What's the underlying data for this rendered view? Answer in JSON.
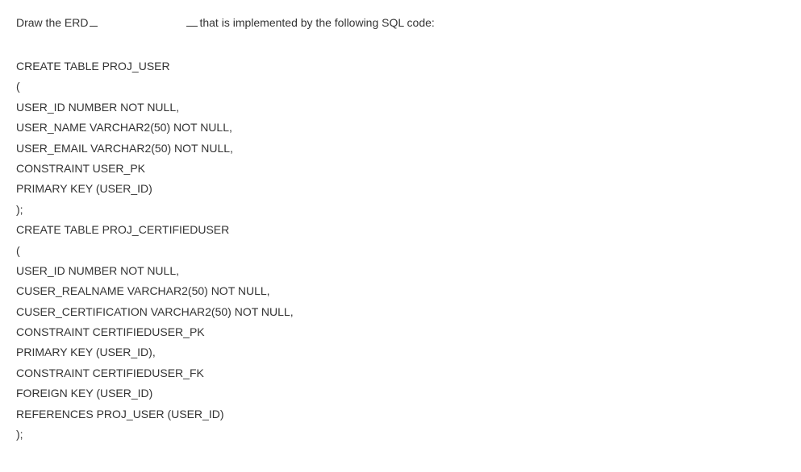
{
  "header": {
    "part1": "Draw the ERD",
    "part2": "that is implemented by the following SQL code:"
  },
  "code": {
    "lines": [
      "CREATE TABLE PROJ_USER",
      "(",
      "USER_ID NUMBER NOT NULL,",
      "USER_NAME VARCHAR2(50) NOT NULL,",
      "USER_EMAIL VARCHAR2(50) NOT NULL,",
      "CONSTRAINT USER_PK",
      "PRIMARY KEY (USER_ID)",
      ");",
      "CREATE TABLE PROJ_CERTIFIEDUSER",
      "(",
      "USER_ID NUMBER NOT NULL,",
      "CUSER_REALNAME VARCHAR2(50) NOT NULL,",
      "CUSER_CERTIFICATION VARCHAR2(50) NOT NULL,",
      "CONSTRAINT CERTIFIEDUSER_PK",
      "PRIMARY KEY (USER_ID),",
      "CONSTRAINT CERTIFIEDUSER_FK",
      "FOREIGN KEY (USER_ID)",
      "REFERENCES PROJ_USER (USER_ID)",
      ");"
    ]
  }
}
